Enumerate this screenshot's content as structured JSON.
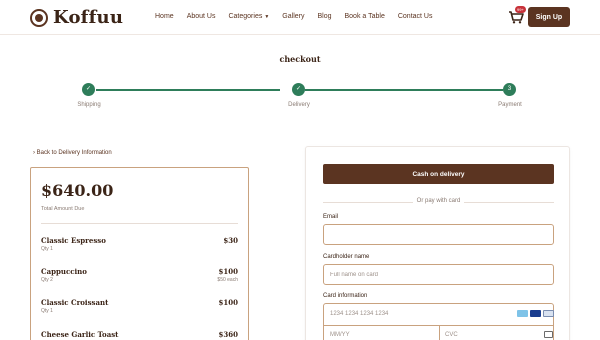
{
  "header": {
    "logo_text": "Koffuu",
    "nav": [
      "Home",
      "About Us",
      "Categories",
      "Gallery",
      "Blog",
      "Book a Table",
      "Contact Us"
    ],
    "cart_badge": "99+",
    "signup_label": "Sign Up"
  },
  "page": {
    "title": "checkout"
  },
  "steps": [
    {
      "label": "Shipping",
      "mark": "✓"
    },
    {
      "label": "Delivery",
      "mark": "✓"
    },
    {
      "label": "Payment",
      "mark": "3"
    }
  ],
  "summary": {
    "back_link": "Back to Delivery Information",
    "total_amount": "$640.00",
    "total_label": "Total Amount Due",
    "items": [
      {
        "name": "Classic Espresso",
        "qty": "Qty 1",
        "price": "$30",
        "each": ""
      },
      {
        "name": "Cappuccino",
        "qty": "Qty 2",
        "price": "$100",
        "each": "$50 each"
      },
      {
        "name": "Classic Croissant",
        "qty": "Qty 1",
        "price": "$100",
        "each": ""
      },
      {
        "name": "Cheese Garlic Toast",
        "qty": "",
        "price": "$360",
        "each": ""
      }
    ]
  },
  "payment": {
    "cod_label": "Cash on delivery",
    "or_text": "Or pay with card",
    "email_label": "Email",
    "email_value": "",
    "cardholder_label": "Cardholder name",
    "cardholder_placeholder": "Full name on card",
    "card_info_label": "Card information",
    "card_number_placeholder": "1234 1234 1234 1234",
    "expiry_placeholder": "MM/YY",
    "cvc_placeholder": "CVC",
    "card_brands": [
      "amex-icon",
      "visa-icon",
      "generic-card-icon"
    ]
  },
  "colors": {
    "brand_brown": "#5b3421",
    "accent_green": "#2e7d5a",
    "field_border": "#c9a27f",
    "badge_red": "#c8323a"
  }
}
